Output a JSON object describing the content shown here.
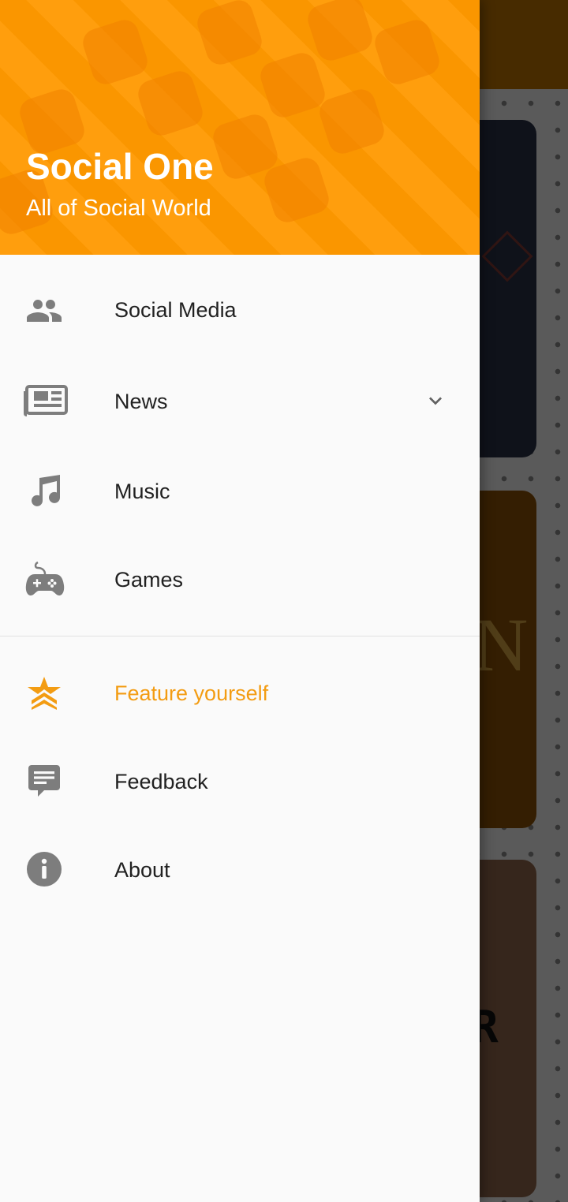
{
  "drawer": {
    "header": {
      "title": "Social One",
      "subtitle": "All of Social World"
    },
    "items": [
      {
        "label": "Social Media",
        "icon": "people-icon"
      },
      {
        "label": "News",
        "icon": "newspaper-icon",
        "expandable": true
      },
      {
        "label": "Music",
        "icon": "music-note-icon"
      },
      {
        "label": "Games",
        "icon": "gamepad-icon"
      }
    ],
    "secondary_items": [
      {
        "label": "Feature yourself",
        "icon": "star-chevron-icon",
        "highlighted": true
      },
      {
        "label": "Feedback",
        "icon": "feedback-icon"
      },
      {
        "label": "About",
        "icon": "info-icon"
      }
    ]
  },
  "colors": {
    "header": "#ff9900",
    "accent": "#f39c12",
    "icon": "#7d7d7d",
    "text": "#212121"
  }
}
